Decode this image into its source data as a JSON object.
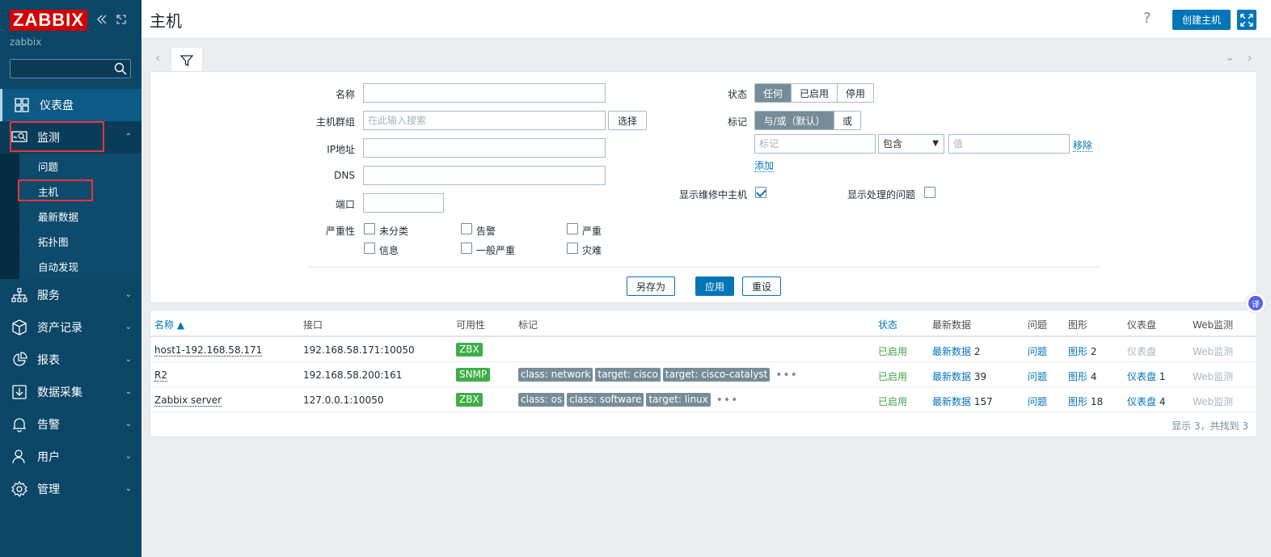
{
  "sidebar": {
    "logo": "ZABBIX",
    "server": "zabbix",
    "search_placeholder": "",
    "menu": [
      {
        "label": "仪表盘"
      },
      {
        "label": "监测"
      },
      {
        "label": "服务"
      },
      {
        "label": "资产记录"
      },
      {
        "label": "报表"
      },
      {
        "label": "数据采集"
      },
      {
        "label": "告警"
      },
      {
        "label": "用户"
      },
      {
        "label": "管理"
      }
    ],
    "submenu": [
      "问题",
      "主机",
      "最新数据",
      "拓扑图",
      "自动发现"
    ]
  },
  "header": {
    "title": "主机",
    "help": "?",
    "create_label": "创建主机"
  },
  "filter": {
    "name_label": "名称",
    "hostgroup_label": "主机群组",
    "hostgroup_placeholder": "在此输入搜索",
    "select_label": "选择",
    "ip_label": "IP地址",
    "dns_label": "DNS",
    "port_label": "端口",
    "severity_label": "严重性",
    "severities": [
      "未分类",
      "告警",
      "严重",
      "信息",
      "一般严重",
      "灾难"
    ],
    "status_label": "状态",
    "status_options": [
      "任何",
      "已启用",
      "停用"
    ],
    "tags_label": "标记",
    "tag_options": [
      "与/或（默认）",
      "或"
    ],
    "tag_placeholder": "标记",
    "tag_operator": "包含",
    "value_placeholder": "值",
    "remove_label": "移除",
    "add_label": "添加",
    "maintenance_label": "显示维修中主机",
    "suppressed_label": "显示处理的问题",
    "save_as_label": "另存为",
    "apply_label": "应用",
    "reset_label": "重设"
  },
  "table": {
    "headers": [
      "名称 ▲",
      "接口",
      "可用性",
      "标记",
      "状态",
      "最新数据",
      "问题",
      "图形",
      "仪表盘",
      "Web监测"
    ],
    "rows": [
      {
        "name": "host1-192.168.58.171",
        "interface": "192.168.58.171:10050",
        "availability": "ZBX",
        "tags": [],
        "status": "已启用",
        "latest": "最新数据",
        "latest_count": "2",
        "problems": "问题",
        "graphs": "图形",
        "graphs_count": "2",
        "dashboards": "仪表盘",
        "dashboards_count": "",
        "web": "Web监测"
      },
      {
        "name": "R2",
        "interface": "192.168.58.200:161",
        "availability": "SNMP",
        "tags": [
          "class: network",
          "target: cisco",
          "target: cisco-catalyst"
        ],
        "status": "已启用",
        "latest": "最新数据",
        "latest_count": "39",
        "problems": "问题",
        "graphs": "图形",
        "graphs_count": "4",
        "dashboards": "仪表盘",
        "dashboards_count": "1",
        "web": "Web监测"
      },
      {
        "name": "Zabbix server",
        "interface": "127.0.0.1:10050",
        "availability": "ZBX",
        "tags": [
          "class: os",
          "class: software",
          "target: linux"
        ],
        "status": "已启用",
        "latest": "最新数据",
        "latest_count": "157",
        "problems": "问题",
        "graphs": "图形",
        "graphs_count": "18",
        "dashboards": "仪表盘",
        "dashboards_count": "4",
        "web": "Web监测"
      }
    ],
    "footer": "显示 3，共找到 3",
    "more": "•••"
  },
  "translate_fab": "译",
  "colors": {
    "sidebar": "#0b4667",
    "accent": "#0275b8",
    "logo_red": "#d40000",
    "enabled": "#429e47"
  }
}
